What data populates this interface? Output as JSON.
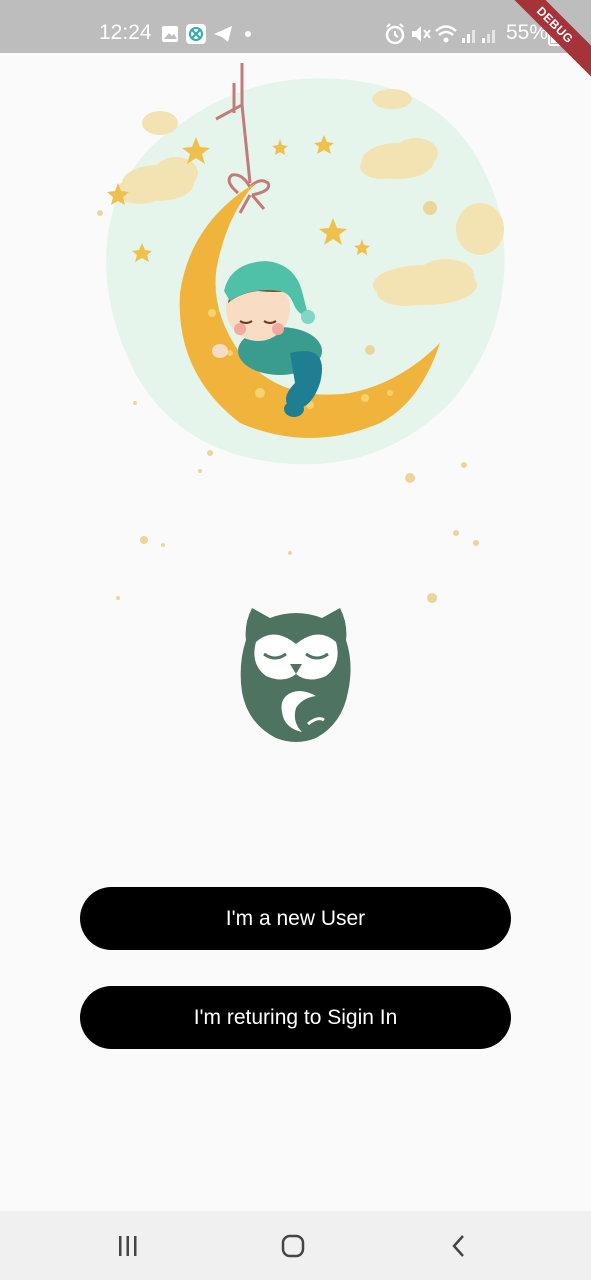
{
  "status_bar": {
    "time": "12:24",
    "battery": "55%",
    "left_icons": [
      "gallery-icon",
      "app-icon",
      "telegram-icon",
      "dot-icon"
    ],
    "right_icons": [
      "alarm-icon",
      "mute-icon",
      "wifi-icon",
      "signal-icon",
      "signal-icon-2"
    ]
  },
  "debug_banner": {
    "label": "DEBUG"
  },
  "buttons": {
    "new_user": "I'm a new User",
    "returning": "I'm returing to Sigin In"
  },
  "colors": {
    "button_bg": "#000000",
    "button_text": "#ffffff",
    "owl": "#4e7360",
    "moon": "#f0b43c",
    "sky": "#e6f5ec"
  },
  "nav_bar": {
    "items": [
      "recents-icon",
      "home-icon",
      "back-icon"
    ]
  }
}
